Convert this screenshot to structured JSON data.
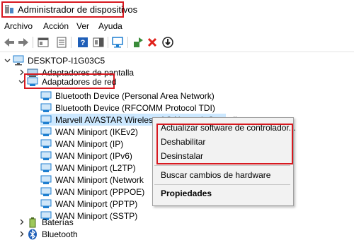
{
  "window": {
    "title": "Administrador de dispositivos"
  },
  "menu": [
    "Archivo",
    "Acción",
    "Ver",
    "Ayuda"
  ],
  "toolbar": {
    "icons": [
      "back-arrow-icon",
      "forward-arrow-icon",
      "console-tree-icon",
      "properties-icon",
      "help-icon",
      "action-pane-icon",
      "scan-hardware-icon",
      "update-driver-icon",
      "uninstall-icon",
      "disable-icon"
    ]
  },
  "tree": {
    "root": "DESKTOP-I1G03C5",
    "display_adapters": "Adaptadores de pantalla",
    "network_adapters": "Adaptadores de red",
    "devices": [
      "Bluetooth Device (Personal Area Network)",
      "Bluetooth Device (RFCOMM Protocol TDI)",
      "Marvell AVASTAR Wireless-AC Network Controller",
      "WAN Miniport (IKEv2)",
      "WAN Miniport (IP)",
      "WAN Miniport (IPv6)",
      "WAN Miniport (L2TP)",
      "WAN Miniport (Network",
      "WAN Miniport (PPPOE)",
      "WAN Miniport (PPTP)",
      "WAN Miniport (SSTP)"
    ],
    "batteries": "Baterías",
    "bluetooth": "Bluetooth"
  },
  "context_menu": {
    "update_driver": "Actualizar software de controlador...",
    "disable": "Deshabilitar",
    "uninstall": "Desinstalar",
    "scan_hardware": "Buscar cambios de hardware",
    "properties": "Propiedades"
  },
  "colors": {
    "highlight": "#d71920",
    "selection": "#cce8ff",
    "network_icon": "#1f7fd0"
  }
}
